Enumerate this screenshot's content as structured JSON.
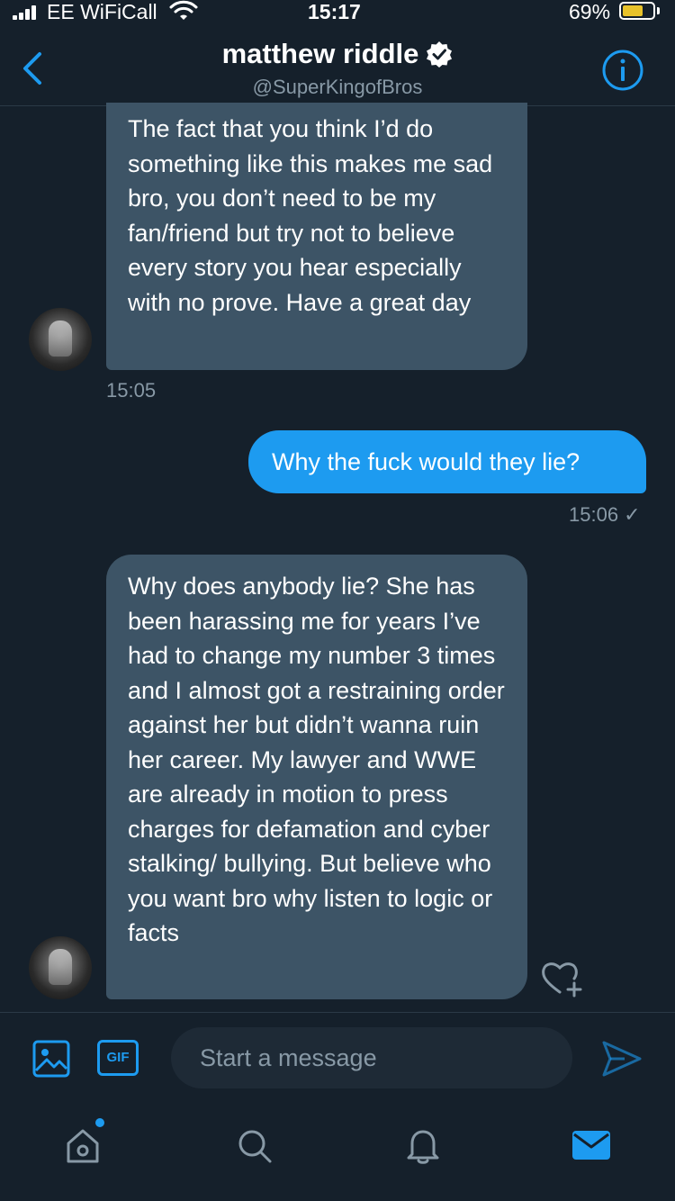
{
  "status_bar": {
    "carrier": "EE WiFiCall",
    "time": "15:17",
    "battery": "69%",
    "battery_level": 0.69
  },
  "header": {
    "name": "matthew riddle",
    "handle": "@SuperKingofBros",
    "verified": true
  },
  "messages": [
    {
      "direction": "incoming",
      "text": "The fact that you think I’d do something like this makes me sad bro, you don’t need to be my fan/friend but try not to believe every story you hear especially with no prove. Have a great day",
      "time": "15:05"
    },
    {
      "direction": "outgoing",
      "text": "Why the fuck would they lie?",
      "time": "15:06 ✓"
    },
    {
      "direction": "incoming",
      "text": "Why does anybody lie? She has been harassing me for years I’ve had to change my number 3 times and I almost got a restraining order against her but didn’t wanna ruin her career. My lawyer and WWE are already in motion to press charges for defamation and cyber stalking/ bullying. But believe who you want bro why listen to logic or facts"
    }
  ],
  "composer": {
    "gif_label": "GIF",
    "placeholder": "Start a message"
  },
  "tabs": [
    "home-icon",
    "search-icon",
    "bell-icon",
    "mail-icon"
  ],
  "colors": {
    "background": "#15202b",
    "accent": "#1d9bf0",
    "incoming_bubble": "#3d5466",
    "secondary_text": "#8899a6"
  }
}
